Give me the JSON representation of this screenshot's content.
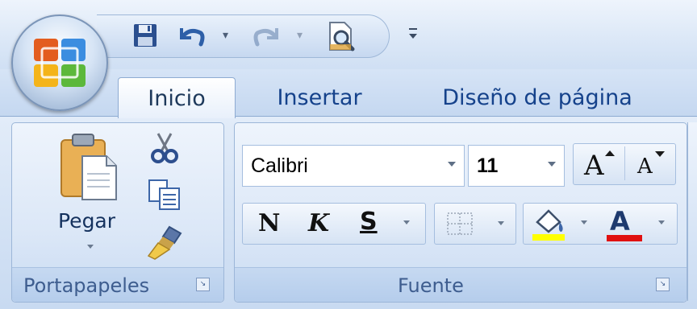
{
  "quick_access": {
    "icons": [
      "save-icon",
      "undo-icon",
      "redo-icon",
      "print-preview-icon",
      "customize-toolbar-icon"
    ]
  },
  "tabs": [
    {
      "label": "Inicio",
      "active": true
    },
    {
      "label": "Insertar",
      "active": false
    },
    {
      "label": "Diseño de página",
      "active": false
    }
  ],
  "groups": {
    "clipboard": {
      "label": "Portapapeles",
      "paste_label": "Pegar",
      "icons": [
        "paste-icon",
        "cut-icon",
        "copy-icon",
        "format-painter-icon"
      ]
    },
    "font": {
      "label": "Fuente",
      "font_name": "Calibri",
      "font_size": "11",
      "grow_label": "A",
      "shrink_label": "A",
      "bold_label": "N",
      "italic_label": "K",
      "underline_label": "S",
      "highlight_color": "#ffff00",
      "font_color": "#e01010"
    }
  },
  "colors": {
    "tab_text": "#15428b",
    "group_label": "#3e5d8f"
  }
}
